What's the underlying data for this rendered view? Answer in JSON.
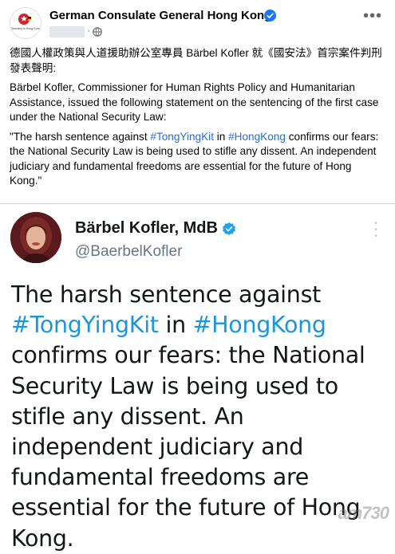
{
  "post": {
    "page_name": "German Consulate General Hong Kong",
    "dot": "·",
    "text_zh": "德國人權政策與人道援助辦公室專員 Bärbel Kofler 就《國安法》首宗案件判刑發表聲明:",
    "text_en_intro": "Bärbel Kofler, Commissioner for Human Rights Policy and Humanitarian Assistance, issued the following statement on the sentencing of the first case under the National Security Law:",
    "quote_part1": "\"The harsh sentence against ",
    "quote_hashtag1": "#TongYingKit",
    "quote_part2": " in ",
    "quote_hashtag2": "#HongKong",
    "quote_part3": " confirms our fears: the National Security Law is being used to stifle any dissent. An independent judiciary and fundamental freedoms are essential for the future of Hong Kong.\"",
    "avatar_text": "Germany in Hong Kong"
  },
  "tweet": {
    "name": "Bärbel Kofler, MdB",
    "handle": "@BaerbelKofler",
    "text_part1": "The harsh sentence against ",
    "hashtag1": "#TongYingKit",
    "text_part2": " in ",
    "hashtag2": "#HongKong",
    "text_part3": " confirms our fears: the National Security Law is being used to stifle any dissent. An independent judiciary and fundamental freedoms are essential for the future of Hong Kong."
  },
  "watermark": "am730",
  "icons": {
    "verified": "verified-badge-icon",
    "globe": "globe-icon",
    "more": "more-options-icon"
  },
  "colors": {
    "fb_link": "#216fdb",
    "tw_link": "#1b95e0",
    "verified_fb": "#1877f2",
    "verified_tw": "#1da1f2"
  }
}
